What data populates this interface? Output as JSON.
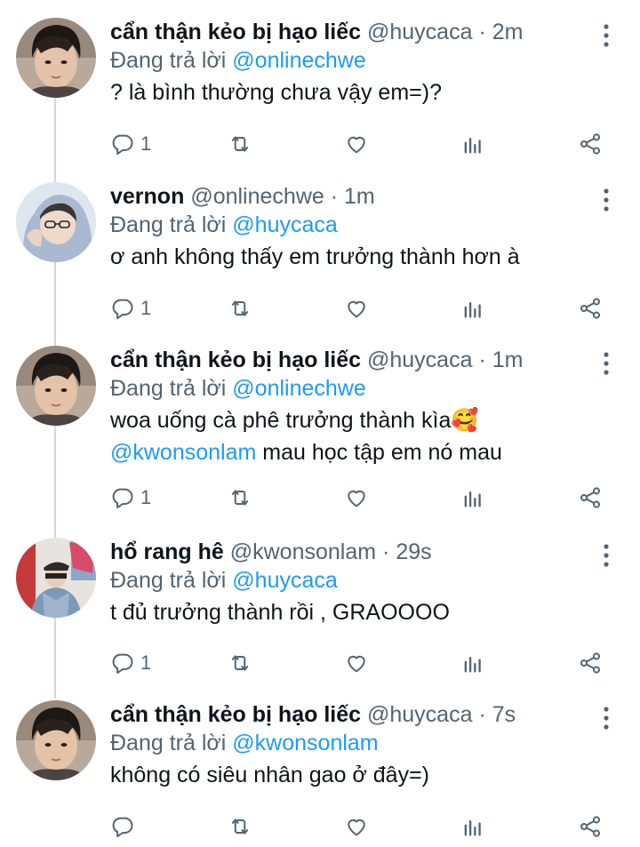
{
  "tweets": [
    {
      "display_name": "cẩn thận kẻo bị hạo liếc",
      "handle": "@huycaca",
      "separator": "·",
      "time": "2m",
      "reply_prefix": "Đang trả lời",
      "reply_to": "@onlinechwe",
      "text_lines": [
        "? là bình thường chưa vậy em=)?"
      ],
      "reply_count": "1",
      "avatar": "avatar-boy-1"
    },
    {
      "display_name": "vernon",
      "handle": "@onlinechwe",
      "separator": "·",
      "time": "1m",
      "reply_prefix": "Đang trả lời",
      "reply_to": "@huycaca",
      "text_lines": [
        "ơ anh không thấy em trưởng thành hơn à"
      ],
      "reply_count": "1",
      "avatar": "avatar-hoodie"
    },
    {
      "display_name": "cẩn thận kẻo bị hạo liếc",
      "handle": "@huycaca",
      "separator": "·",
      "time": "1m",
      "reply_prefix": "Đang trả lời",
      "reply_to": "@onlinechwe",
      "text_lines": [
        "woa uống cà phê trưởng thành kìa🥰"
      ],
      "text_mention": "@kwonsonlam",
      "text_after_mention": " mau học tập em nó mau",
      "reply_count": "1",
      "avatar": "avatar-boy-1"
    },
    {
      "display_name": "hổ rang hê",
      "handle": "@kwonsonlam",
      "separator": "·",
      "time": "29s",
      "reply_prefix": "Đang trả lời",
      "reply_to": "@huycaca",
      "text_lines": [
        "t đủ trưởng thành rồi , GRAOOOO"
      ],
      "reply_count": "1",
      "avatar": "avatar-cap"
    },
    {
      "display_name": "cẩn thận kẻo bị hạo liếc",
      "handle": "@huycaca",
      "separator": "·",
      "time": "7s",
      "reply_prefix": "Đang trả lời",
      "reply_to": "@kwonsonlam",
      "text_lines": [
        "không có siêu nhân gao ở đây=)"
      ],
      "reply_count": "",
      "avatar": "avatar-boy-1"
    }
  ],
  "icons": {
    "reply": "reply-icon",
    "retweet": "retweet-icon",
    "like": "heart-icon",
    "analytics": "analytics-icon",
    "share": "share-icon",
    "more": "more-vertical-icon"
  },
  "colors": {
    "mention": "#1d9bf0",
    "secondary": "#536471",
    "primary": "#0f1419",
    "thread_line": "#cfd9de"
  }
}
